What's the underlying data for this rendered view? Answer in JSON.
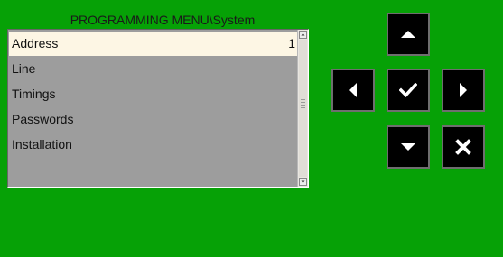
{
  "menu": {
    "title": "PROGRAMMING MENU\\System",
    "items": [
      {
        "label": "Address",
        "value": "1",
        "selected": true
      },
      {
        "label": "Line",
        "value": ""
      },
      {
        "label": "Timings",
        "value": ""
      },
      {
        "label": "Passwords",
        "value": ""
      },
      {
        "label": "Installation",
        "value": ""
      }
    ]
  },
  "buttons": {
    "up": "up-arrow-icon",
    "left": "left-arrow-icon",
    "confirm": "checkmark-icon",
    "right": "right-arrow-icon",
    "down": "down-arrow-icon",
    "cancel": "cancel-x-icon"
  },
  "colors": {
    "background": "#06a106",
    "list_background": "#9d9d9d",
    "selected_row": "#fdf6e4",
    "button_background": "#000000",
    "icon_color": "#ffffff"
  }
}
